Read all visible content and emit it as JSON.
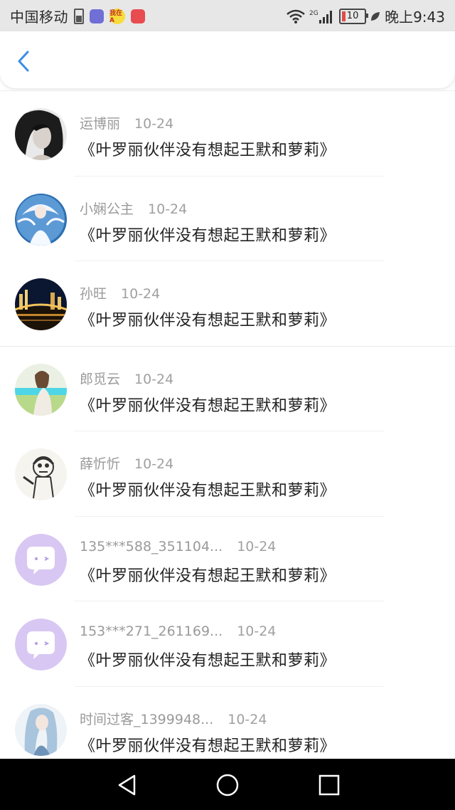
{
  "status_bar": {
    "carrier": "中国移动",
    "app_badge_text": "我在A",
    "battery": "10",
    "time": "晚上9:43"
  },
  "list": {
    "items": [
      {
        "name": "运博丽",
        "date": "10-24",
        "text": "《叶罗丽伙伴没有想起王默和萝莉》",
        "avatar": "portrait-photo"
      },
      {
        "name": "小娴公主",
        "date": "10-24",
        "text": "《叶罗丽伙伴没有想起王默和萝莉》",
        "avatar": "anime-princess"
      },
      {
        "name": "孙旺",
        "date": "10-24",
        "text": "《叶罗丽伙伴没有想起王默和萝莉》",
        "avatar": "night-bridge"
      },
      {
        "name": "郎觅云",
        "date": "10-24",
        "text": "《叶罗丽伙伴没有想起王默和萝莉》",
        "avatar": "girl-meadow"
      },
      {
        "name": "薛忻忻",
        "date": "10-24",
        "text": "《叶罗丽伙伴没有想起王默和萝莉》",
        "avatar": "sketch-character"
      },
      {
        "name": "135***588_351104...",
        "date": "10-24",
        "text": "《叶罗丽伙伴没有想起王默和萝莉》",
        "avatar": "default-chat"
      },
      {
        "name": "153***271_261169...",
        "date": "10-24",
        "text": "《叶罗丽伙伴没有想起王默和萝莉》",
        "avatar": "default-chat"
      },
      {
        "name": "时间过客_1399948...",
        "date": "10-24",
        "text": "《叶罗丽伙伴没有想起王默和萝莉》",
        "avatar": "anime-swordsman"
      }
    ]
  },
  "colors": {
    "accent": "#3a8ee6",
    "default_avatar": "#d8c7f3"
  }
}
